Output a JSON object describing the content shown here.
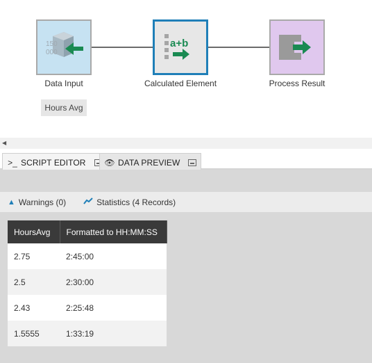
{
  "flow": {
    "nodes": [
      {
        "label": "Data Input",
        "icon": "data-input-icon"
      },
      {
        "label": "Calculated Element",
        "icon": "calculated-element-icon"
      },
      {
        "label": "Process Result",
        "icon": "process-result-icon"
      }
    ],
    "input_tag": "Hours Avg",
    "accent": "#1f7fb8",
    "arrow_color": "#1a8a52"
  },
  "tabs": [
    {
      "label": "SCRIPT EDITOR",
      "icon": "terminal-icon",
      "active": false
    },
    {
      "label": "DATA PREVIEW",
      "icon": "eye-icon",
      "active": true
    }
  ],
  "status": {
    "warnings": "Warnings (0)",
    "statistics": "Statistics (4 Records)"
  },
  "table": {
    "columns": [
      "HoursAvg",
      "Formatted to HH:MM:SS"
    ],
    "rows": [
      [
        "2.75",
        "2:45:00"
      ],
      [
        "2.5",
        "2:30:00"
      ],
      [
        "2.43",
        "2:25:48"
      ],
      [
        "1.5555",
        "1:33:19"
      ]
    ]
  }
}
